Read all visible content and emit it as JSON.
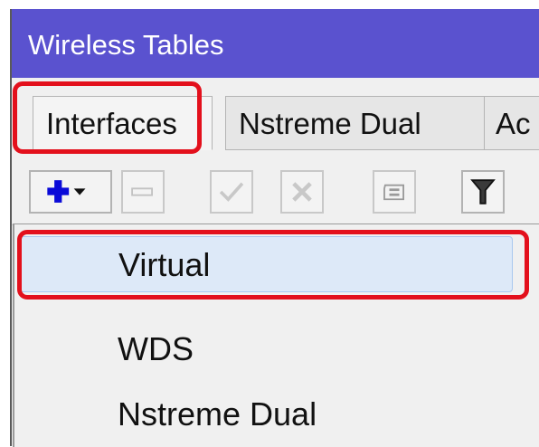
{
  "window": {
    "title": "Wireless Tables"
  },
  "tabs": [
    {
      "label": "Interfaces",
      "active": true
    },
    {
      "label": "Nstreme Dual",
      "active": false
    },
    {
      "label": "Ac",
      "active": false
    }
  ],
  "toolbar": {
    "buttons": [
      {
        "icon": "add-icon",
        "enabled": true,
        "has_dropdown": true
      },
      {
        "icon": "remove-icon",
        "enabled": false
      },
      {
        "icon": "enable-icon",
        "enabled": false
      },
      {
        "icon": "disable-icon",
        "enabled": false
      },
      {
        "icon": "comment-icon",
        "enabled": false
      },
      {
        "icon": "filter-icon",
        "enabled": true
      }
    ]
  },
  "add_menu": {
    "items": [
      {
        "label": "Virtual",
        "highlighted": true
      },
      {
        "label": "WDS",
        "highlighted": false
      },
      {
        "label": "Nstreme Dual",
        "highlighted": false
      }
    ]
  },
  "colors": {
    "titlebar": "#5a52cf",
    "annotation": "#e3101c",
    "add_icon": "#0a0ad8",
    "menu_hover": "#dde9f8"
  }
}
